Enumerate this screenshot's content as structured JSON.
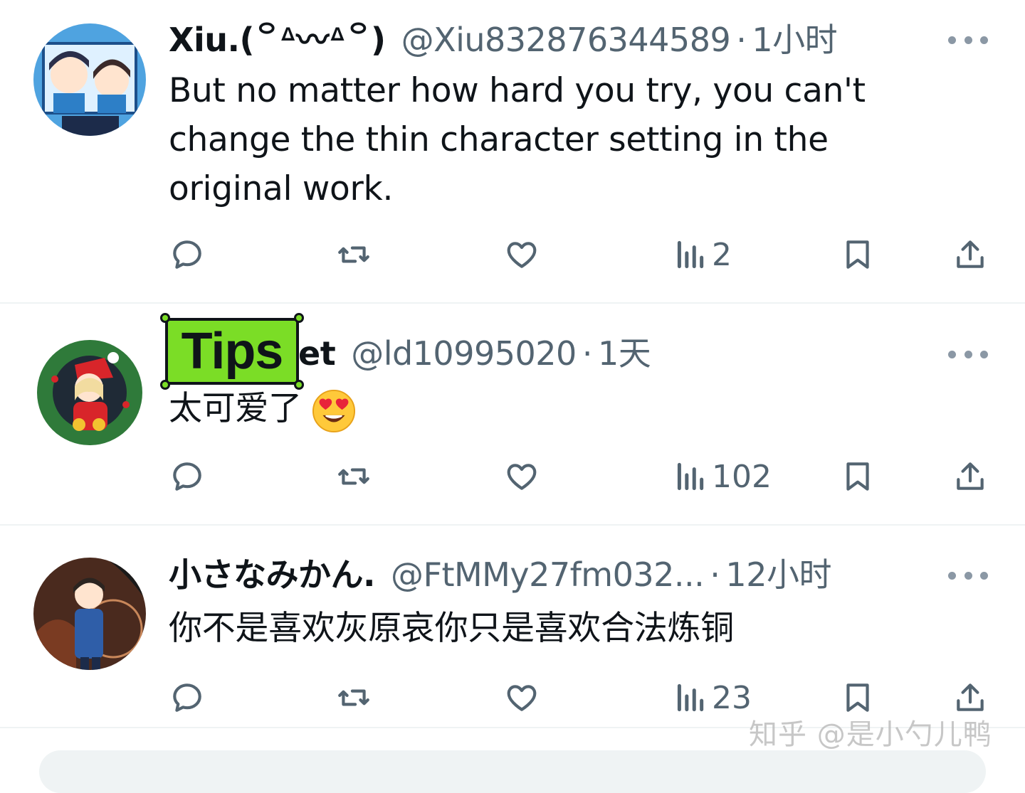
{
  "tweets": [
    {
      "display_name": "Xiu.(꒪ᐞ〰ᐞ꒪)",
      "handle": "@Xiu832876344589",
      "separator": "·",
      "time": "1小时",
      "text": "But no matter how hard you try, you can't change the thin character setting in the original work.",
      "views": "2"
    },
    {
      "display_name": "et",
      "handle": "@ld10995020",
      "separator": "·",
      "time": "1天",
      "text": "太可爱了",
      "emoji": "heart-eyes-emoji",
      "views": "102"
    },
    {
      "display_name": "小さなみかん.",
      "handle": "@FtMMy27fm032...",
      "separator": "·",
      "time": "12小时",
      "text": "你不是喜欢灰原哀你只是喜欢合法炼铜",
      "views": "23"
    }
  ],
  "overlay": {
    "tips_label": "Tips"
  },
  "watermark": "知乎 @是小勺儿鸭",
  "icons": [
    "reply-icon",
    "retweet-icon",
    "like-icon",
    "views-icon",
    "bookmark-icon",
    "share-icon",
    "more-icon"
  ],
  "colors": {
    "text": "#0f1419",
    "secondary": "#536471",
    "divider": "#eff3f4",
    "tips_bg": "#7bdd26"
  }
}
